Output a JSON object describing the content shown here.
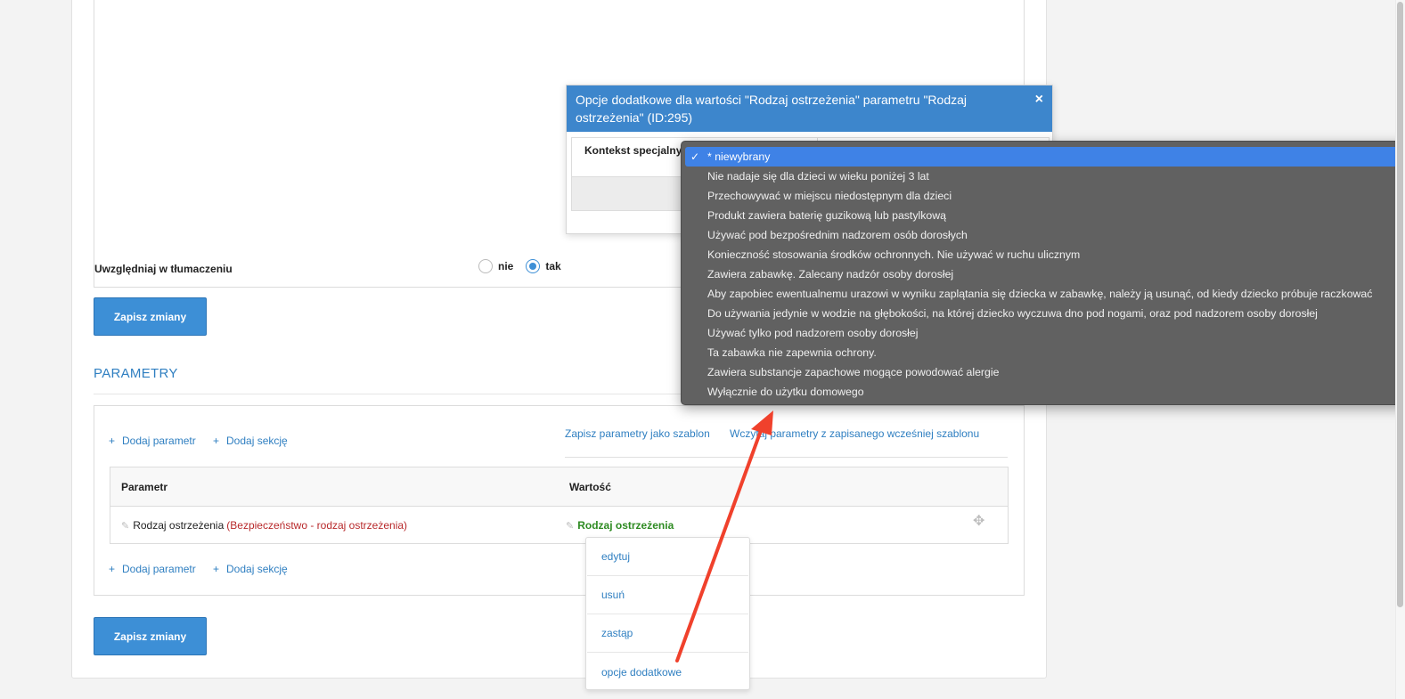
{
  "form": {
    "translate_label": "Uwzględniaj w tłumaczeniu",
    "translate_options": [
      {
        "label": "nie",
        "checked": false
      },
      {
        "label": "tak",
        "checked": true
      }
    ],
    "save_label": "Zapisz zmiany"
  },
  "parameters": {
    "section_title": "PARAMETRY",
    "add_param": "Dodaj parametr",
    "add_section": "Dodaj sekcję",
    "save_template": "Zapisz parametry jako szablon",
    "load_template": "Wczytaj parametry z zapisanego wcześniej szablonu",
    "table": {
      "col_param": "Parametr",
      "col_value": "Wartość",
      "row": {
        "name": "Rodzaj ostrzeżenia",
        "category": "(Bezpieczeństwo - rodzaj ostrzeżenia)",
        "value": "Rodzaj ostrzeżenia"
      }
    }
  },
  "context_menu": {
    "items": [
      "edytuj",
      "usuń",
      "zastąp",
      "opcje dodatkowe"
    ]
  },
  "modal": {
    "title": "Opcje dodatkowe dla wartości \"Rodzaj ostrzeżenia\" parametru \"Rodzaj ostrzeżenia\" (ID:295)",
    "close": "×",
    "field_label": "Kontekst specjalny"
  },
  "dropdown": {
    "check": "✓",
    "options": [
      "* niewybrany",
      "Nie nadaje się dla dzieci w wieku poniżej 3 lat",
      "Przechowywać w miejscu niedostępnym dla dzieci",
      "Produkt zawiera baterię guzikową lub pastylkową",
      "Używać pod bezpośrednim nadzorem osób dorosłych",
      "Konieczność stosowania środków ochronnych. Nie używać w ruchu ulicznym",
      "Zawiera zabawkę. Zalecany nadzór osoby dorosłej",
      "Aby zapobiec ewentualnemu urazowi w wyniku zaplątania się dziecka w zabawkę, należy ją usunąć, od kiedy dziecko próbuje raczkować",
      "Do używania jedynie w wodzie na głębokości, na której dziecko wyczuwa dno pod nogami, oraz pod nadzorem osoby dorosłej",
      "Używać tylko pod nadzorem osoby dorosłej",
      "Ta zabawka nie zapewnia ochrony.",
      "Zawiera substancje zapachowe mogące powodować alergie",
      "Wyłącznie do użytku domowego"
    ],
    "selected_index": 0
  },
  "colors": {
    "accent": "#3d8fd6",
    "arrow": "#f0412c",
    "value_green": "#2e8b22",
    "category_red": "#b8292b"
  },
  "icons": {
    "close": "close-icon",
    "move": "move-icon",
    "pencil": "pencil-icon",
    "check": "checkmark-icon"
  }
}
